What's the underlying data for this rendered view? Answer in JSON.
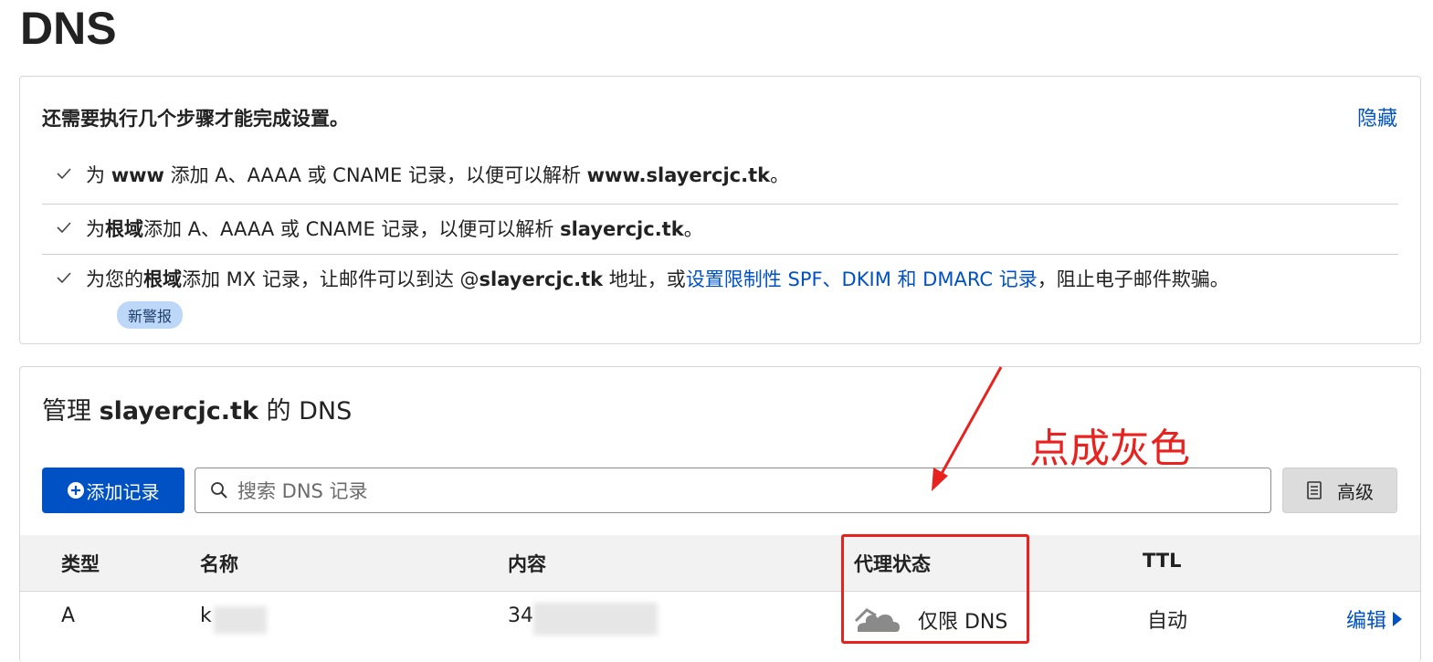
{
  "page": {
    "title": "DNS"
  },
  "setup": {
    "heading": "还需要执行几个步骤才能完成设置。",
    "hide_label": "隐藏",
    "steps": [
      {
        "p1": "为 ",
        "b1": "www",
        "p2": " 添加 A、AAAA 或 CNAME 记录，以便可以解析 ",
        "b2": "www.slayercjc.tk",
        "p3": "。"
      },
      {
        "p1": "为",
        "b1": "根域",
        "p2": "添加 A、AAAA 或 CNAME 记录，以便可以解析 ",
        "b2": "slayercjc.tk",
        "p3": "。"
      },
      {
        "p1": "为您的",
        "b1": "根域",
        "p2": "添加 MX 记录，让邮件可以到达 @",
        "b2": "slayercjc.tk",
        "p3": " 地址，或",
        "link": "设置限制性 SPF、DKIM 和 DMARC 记录",
        "p4": "，阻止电子邮件欺骗。",
        "badge": "新警报"
      }
    ]
  },
  "dns": {
    "heading_prefix": "管理 ",
    "domain": "slayercjc.tk",
    "heading_suffix": " 的 DNS",
    "add_button": "添加记录",
    "search_placeholder": "搜索 DNS 记录",
    "advanced_button": "高级",
    "columns": [
      "类型",
      "名称",
      "内容",
      "代理状态",
      "TTL"
    ],
    "rows": [
      {
        "type": "A",
        "name": "k",
        "content": "34",
        "proxy": "仅限 DNS",
        "ttl": "自动",
        "edit": "编辑"
      }
    ]
  },
  "annotation": {
    "text": "点成灰色",
    "color": "#e8231f"
  },
  "colors": {
    "accent": "#0051c3",
    "badge_bg": "#bcd7f7",
    "header_bg": "#f2f2f2"
  },
  "icons": {
    "check": "check-icon",
    "plus": "plus-circle-icon",
    "search": "search-icon",
    "advanced": "document-icon",
    "proxy": "grey-cloud-icon",
    "edit": "caret-right-icon"
  }
}
